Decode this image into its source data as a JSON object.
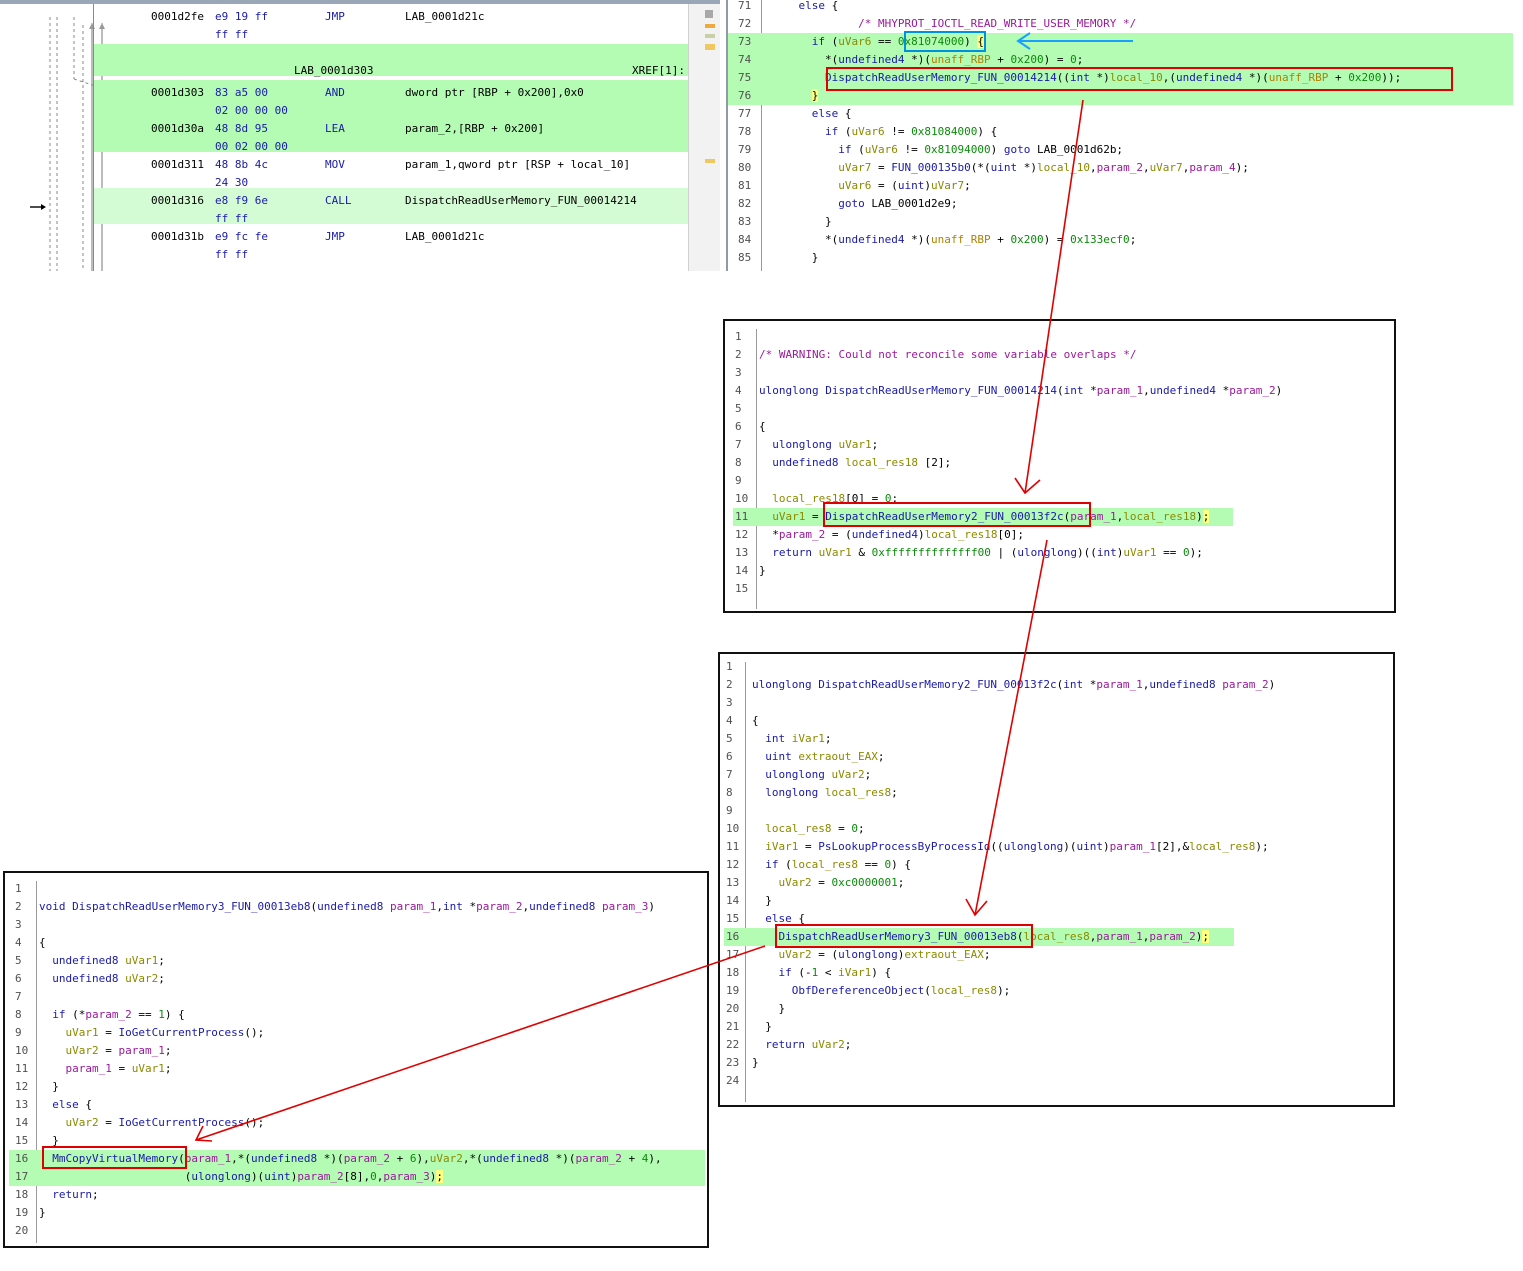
{
  "listing": {
    "rows": [
      {
        "addr": "0001d2fe",
        "bytes": "e9 19 ff\nff ff",
        "mnemonic": "JMP",
        "operands": "LAB_0001d21c",
        "hl": ""
      },
      {
        "label": "LAB_0001d303",
        "xref": "XREF[1]:",
        "hl": "hl"
      },
      {
        "addr": "0001d303",
        "bytes": "83 a5 00\n02 00 00 00",
        "mnemonic": "AND",
        "operands": "dword ptr [RBP + 0x200],0x0",
        "hl": "hl"
      },
      {
        "addr": "0001d30a",
        "bytes": "48 8d 95\n00 02 00 00",
        "mnemonic": "LEA",
        "operands": "param_2,[RBP + 0x200]",
        "hl": "hl"
      },
      {
        "addr": "0001d311",
        "bytes": "48 8b 4c\n24 30",
        "mnemonic": "MOV",
        "operands": "param_1,qword ptr [RSP + local_10]",
        "hl": ""
      },
      {
        "addr": "0001d316",
        "bytes": "e8 f9 6e\nff ff",
        "mnemonic": "CALL",
        "operands": "DispatchReadUserMemory_FUN_00014214",
        "hl": "hl2"
      },
      {
        "addr": "0001d31b",
        "bytes": "e9 fc fe\nff ff",
        "mnemonic": "JMP",
        "operands": "LAB_0001d21c",
        "hl": ""
      }
    ]
  },
  "decompiler_main": {
    "lines": [
      {
        "n": "71",
        "html": "    <span class='kw'>else</span> {"
      },
      {
        "n": "72",
        "html": "             <span class='cmt'>/* MHYPROT_IOCTL_READ_WRITE_USER_MEMORY */</span>"
      },
      {
        "n": "73",
        "html": "      <span class='kw'>if</span> (<span class='var'>uVar6</span> == <span class='num'>0x81074000</span>) <span class='ybrace'>{</span>",
        "hl": true
      },
      {
        "n": "74",
        "html": "        *(<span class='ty'>undefined4</span> *)(<span class='glb'>unaff_RBP</span> + <span class='num'>0x200</span>) = <span class='num'>0</span>;",
        "hl": true
      },
      {
        "n": "75",
        "html": "        <span class='fn'>DispatchReadUserMemory_FUN_00014214</span>((<span class='ty'>int</span> *)<span class='var'>local_10</span>,(<span class='ty'>undefined4</span> *)(<span class='glb'>unaff_RBP</span> + <span class='num'>0x200</span>));",
        "hl": true
      },
      {
        "n": "76",
        "html": "      <span class='ybrace'>}</span>",
        "hl": true
      },
      {
        "n": "77",
        "html": "      <span class='kw'>else</span> {"
      },
      {
        "n": "78",
        "html": "        <span class='kw'>if</span> (<span class='var'>uVar6</span> != <span class='num'>0x81084000</span>) {"
      },
      {
        "n": "79",
        "html": "          <span class='kw'>if</span> (<span class='var'>uVar6</span> != <span class='num'>0x81094000</span>) <span class='kw'>goto</span> LAB_0001d62b;"
      },
      {
        "n": "80",
        "html": "          <span class='var'>uVar7</span> = <span class='fn'>FUN_000135b0</span>(*(<span class='ty'>uint</span> *)<span class='var'>local_10</span>,<span class='prm'>param_2</span>,<span class='var'>uVar7</span>,<span class='prm'>param_4</span>);"
      },
      {
        "n": "81",
        "html": "          <span class='var'>uVar6</span> = (<span class='ty'>uint</span>)<span class='var'>uVar7</span>;"
      },
      {
        "n": "82",
        "html": "          <span class='kw'>goto</span> LAB_0001d2e9;"
      },
      {
        "n": "83",
        "html": "        }"
      },
      {
        "n": "84",
        "html": "        *(<span class='ty'>undefined4</span> *)(<span class='glb'>unaff_RBP</span> + <span class='num'>0x200</span>) = <span class='num'>0x133ecf0</span>;"
      },
      {
        "n": "85",
        "html": "      }"
      }
    ]
  },
  "panel_read1": {
    "lines": [
      {
        "n": "1",
        "html": ""
      },
      {
        "n": "2",
        "html": "<span class='cmt'>/* WARNING: Could not reconcile some variable overlaps */</span>"
      },
      {
        "n": "3",
        "html": ""
      },
      {
        "n": "4",
        "html": "<span class='ty'>ulonglong</span> <span class='fn'>DispatchReadUserMemory_FUN_00014214</span>(<span class='ty'>int</span> *<span class='prm'>param_1</span>,<span class='ty'>undefined4</span> *<span class='prm'>param_2</span>)"
      },
      {
        "n": "5",
        "html": ""
      },
      {
        "n": "6",
        "html": "{"
      },
      {
        "n": "7",
        "html": "  <span class='ty'>ulonglong</span> <span class='var'>uVar1</span>;"
      },
      {
        "n": "8",
        "html": "  <span class='ty'>undefined8</span> <span class='var'>local_res18</span> [2];"
      },
      {
        "n": "9",
        "html": ""
      },
      {
        "n": "10",
        "html": "  <span class='var'>local_res18</span>[0] = <span class='num'>0</span>;"
      },
      {
        "n": "11",
        "html": "  <span class='var'>uVar1</span> = <span class='fn'>DispatchReadUserMemory2_FUN_00013f2c</span>(<span class='prm'>param_1</span>,<span class='var'>local_res18</span>)<span class='ybrace'>;</span>",
        "hl": true
      },
      {
        "n": "12",
        "html": "  *<span class='prm'>param_2</span> = (<span class='ty'>undefined4</span>)<span class='var'>local_res18</span>[0];"
      },
      {
        "n": "13",
        "html": "  <span class='kw'>return</span> <span class='var'>uVar1</span> &amp; <span class='num'>0xffffffffffffff00</span> | (<span class='ty'>ulonglong</span>)((<span class='ty'>int</span>)<span class='var'>uVar1</span> == <span class='num'>0</span>);"
      },
      {
        "n": "14",
        "html": "}"
      },
      {
        "n": "15",
        "html": ""
      }
    ]
  },
  "panel_read2": {
    "lines": [
      {
        "n": "1",
        "html": ""
      },
      {
        "n": "2",
        "html": "<span class='ty'>ulonglong</span> <span class='fn'>DispatchReadUserMemory2_FUN_00013f2c</span>(<span class='ty'>int</span> *<span class='prm'>param_1</span>,<span class='ty'>undefined8</span> <span class='prm'>param_2</span>)"
      },
      {
        "n": "3",
        "html": ""
      },
      {
        "n": "4",
        "html": "{"
      },
      {
        "n": "5",
        "html": "  <span class='ty'>int</span> <span class='var'>iVar1</span>;"
      },
      {
        "n": "6",
        "html": "  <span class='ty'>uint</span> <span class='var'>extraout_EAX</span>;"
      },
      {
        "n": "7",
        "html": "  <span class='ty'>ulonglong</span> <span class='var'>uVar2</span>;"
      },
      {
        "n": "8",
        "html": "  <span class='ty'>longlong</span> <span class='var'>local_res8</span>;"
      },
      {
        "n": "9",
        "html": ""
      },
      {
        "n": "10",
        "html": "  <span class='var'>local_res8</span> = <span class='num'>0</span>;"
      },
      {
        "n": "11",
        "html": "  <span class='var'>iVar1</span> = <span class='fn'>PsLookupProcessByProcessId</span>((<span class='ty'>ulonglong</span>)(<span class='ty'>uint</span>)<span class='prm'>param_1</span>[2],&amp;<span class='var'>local_res8</span>);"
      },
      {
        "n": "12",
        "html": "  <span class='kw'>if</span> (<span class='var'>local_res8</span> == <span class='num'>0</span>) {"
      },
      {
        "n": "13",
        "html": "    <span class='var'>uVar2</span> = <span class='num'>0xc0000001</span>;"
      },
      {
        "n": "14",
        "html": "  }"
      },
      {
        "n": "15",
        "html": "  <span class='kw'>else</span> {"
      },
      {
        "n": "16",
        "html": "    <span class='fn'>DispatchReadUserMemory3_FUN_00013eb8</span>(<span class='var'>local_res8</span>,<span class='prm'>param_1</span>,<span class='prm'>param_2</span>)<span class='ybrace'>;</span>",
        "hl": true
      },
      {
        "n": "17",
        "html": "    <span class='var'>uVar2</span> = (<span class='ty'>ulonglong</span>)<span class='var'>extraout_EAX</span>;"
      },
      {
        "n": "18",
        "html": "    <span class='kw'>if</span> (-<span class='num'>1</span> &lt; <span class='var'>iVar1</span>) {"
      },
      {
        "n": "19",
        "html": "      <span class='fn'>ObfDereferenceObject</span>(<span class='var'>local_res8</span>);"
      },
      {
        "n": "20",
        "html": "    }"
      },
      {
        "n": "21",
        "html": "  }"
      },
      {
        "n": "22",
        "html": "  <span class='kw'>return</span> <span class='var'>uVar2</span>;"
      },
      {
        "n": "23",
        "html": "}"
      },
      {
        "n": "24",
        "html": ""
      }
    ]
  },
  "panel_read3": {
    "lines": [
      {
        "n": "1",
        "html": ""
      },
      {
        "n": "2",
        "html": "<span class='kw'>void</span> <span class='fn'>DispatchReadUserMemory3_FUN_00013eb8</span>(<span class='ty'>undefined8</span> <span class='prm'>param_1</span>,<span class='ty'>int</span> *<span class='prm'>param_2</span>,<span class='ty'>undefined8</span> <span class='prm'>param_3</span>)"
      },
      {
        "n": "3",
        "html": ""
      },
      {
        "n": "4",
        "html": "{"
      },
      {
        "n": "5",
        "html": "  <span class='ty'>undefined8</span> <span class='var'>uVar1</span>;"
      },
      {
        "n": "6",
        "html": "  <span class='ty'>undefined8</span> <span class='var'>uVar2</span>;"
      },
      {
        "n": "7",
        "html": ""
      },
      {
        "n": "8",
        "html": "  <span class='kw'>if</span> (*<span class='prm'>param_2</span> == <span class='num'>1</span>) {"
      },
      {
        "n": "9",
        "html": "    <span class='var'>uVar1</span> = <span class='fn'>IoGetCurrentProcess</span>();"
      },
      {
        "n": "10",
        "html": "    <span class='var'>uVar2</span> = <span class='prm'>param_1</span>;"
      },
      {
        "n": "11",
        "html": "    <span class='prm'>param_1</span> = <span class='var'>uVar1</span>;"
      },
      {
        "n": "12",
        "html": "  }"
      },
      {
        "n": "13",
        "html": "  <span class='kw'>else</span> {"
      },
      {
        "n": "14",
        "html": "    <span class='var'>uVar2</span> = <span class='fn'>IoGetCurrentProcess</span>();"
      },
      {
        "n": "15",
        "html": "  }"
      },
      {
        "n": "16",
        "html": "  <span class='fn'>MmCopyVirtualMemory</span>(<span class='prm'>param_1</span>,*(<span class='ty'>undefined8</span> *)(<span class='prm'>param_2</span> + <span class='num'>6</span>),<span class='var'>uVar2</span>,*(<span class='ty'>undefined8</span> *)(<span class='prm'>param_2</span> + <span class='num'>4</span>),",
        "hl": true
      },
      {
        "n": "17",
        "html": "                      (<span class='ty'>ulonglong</span>)(<span class='ty'>uint</span>)<span class='prm'>param_2</span>[8],<span class='num'>0</span>,<span class='prm'>param_3</span>)<span class='ybrace'>;</span>",
        "hl": true
      },
      {
        "n": "18",
        "html": "  <span class='kw'>return</span>;"
      },
      {
        "n": "19",
        "html": "}"
      },
      {
        "n": "20",
        "html": ""
      }
    ]
  }
}
